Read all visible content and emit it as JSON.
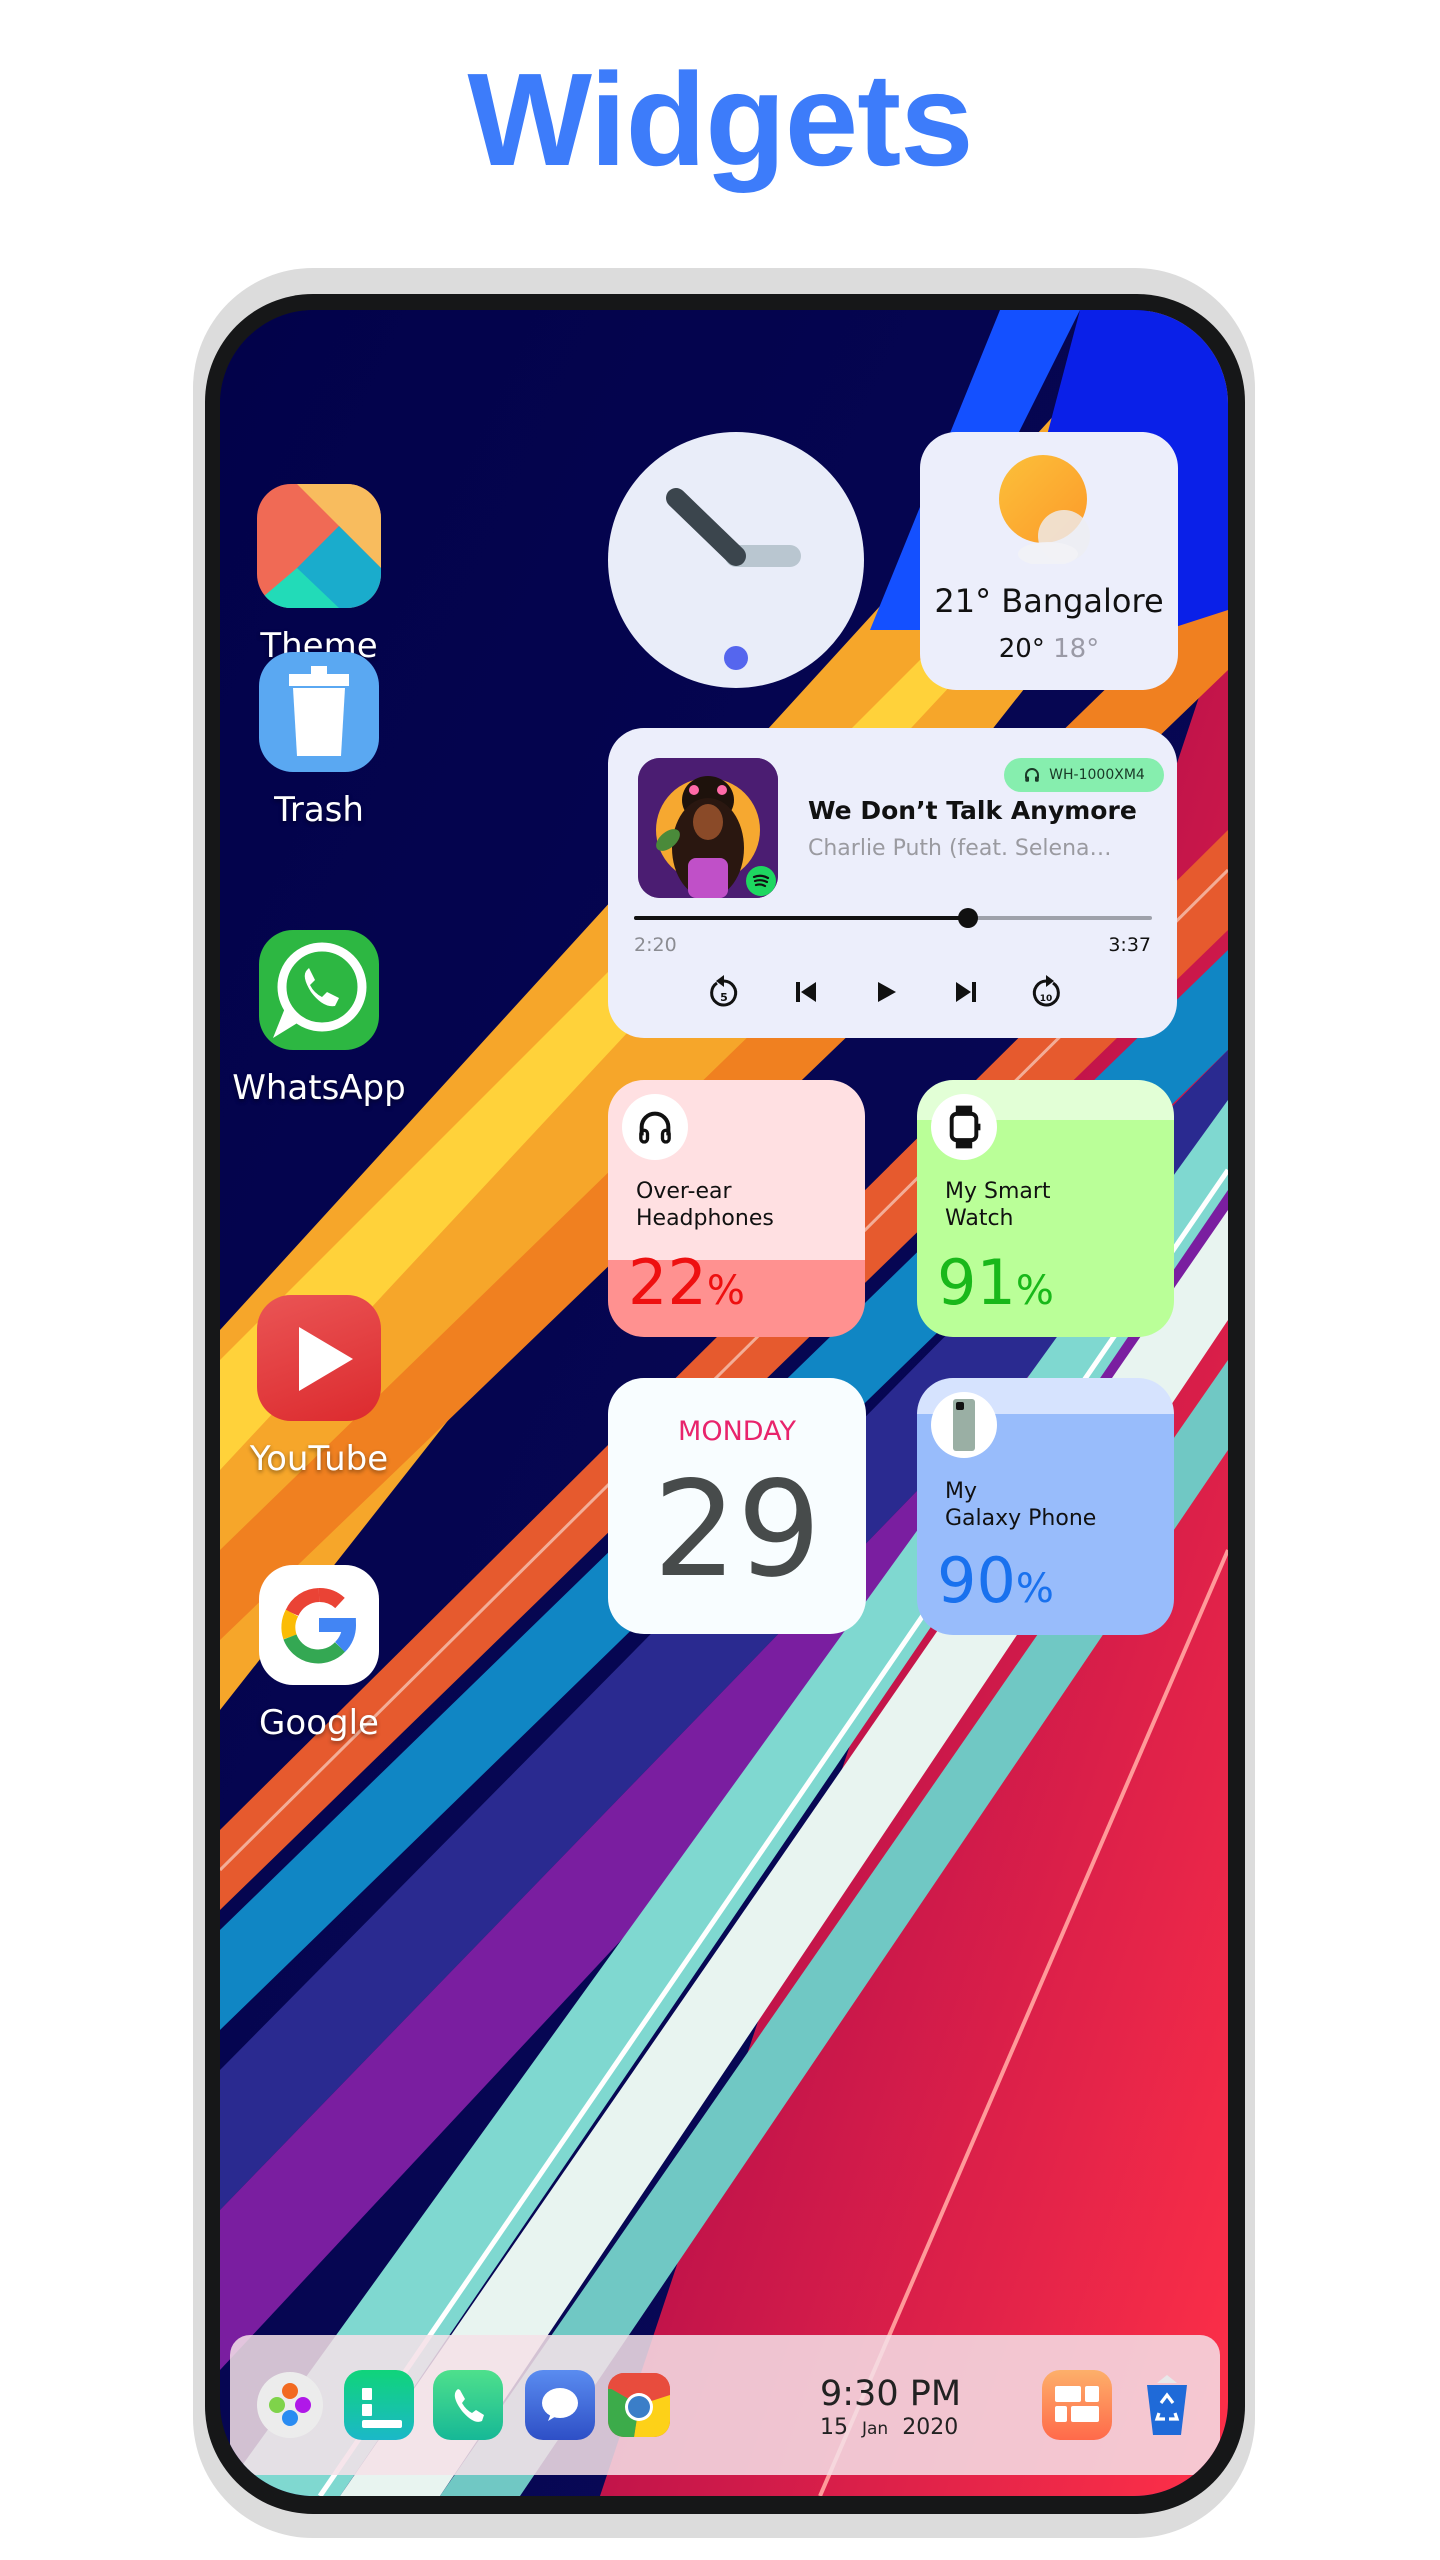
{
  "page": {
    "title": "Widgets",
    "accent_color": "#3d7cfa"
  },
  "home_apps": [
    {
      "label": "Theme",
      "icon": "theme-icon"
    },
    {
      "label": "Trash",
      "icon": "trash-icon"
    },
    {
      "label": "WhatsApp",
      "icon": "whatsapp-icon"
    },
    {
      "label": "YouTube",
      "icon": "youtube-icon"
    },
    {
      "label": "Google",
      "icon": "google-icon"
    }
  ],
  "clock_widget": {
    "icon": "analog-clock-icon"
  },
  "weather_widget": {
    "temperature": "21°",
    "city": "Bangalore",
    "high": "20°",
    "low": "18°",
    "icon": "sun-cloud-icon"
  },
  "music_widget": {
    "device_badge": "WH-1000XM4",
    "song_title": "We Don’t Talk Anymore",
    "artist": "Charlie Puth (feat. Selena…",
    "current_time": "2:20",
    "total_time": "3:37",
    "progress_fraction": 0.645,
    "source_icon": "spotify-icon",
    "controls": [
      {
        "name": "rewind-5-button",
        "icon": "replay-5-icon"
      },
      {
        "name": "previous-button",
        "icon": "skip-previous-icon"
      },
      {
        "name": "play-button",
        "icon": "play-icon"
      },
      {
        "name": "next-button",
        "icon": "skip-next-icon"
      },
      {
        "name": "forward-10-button",
        "icon": "forward-10-icon"
      }
    ]
  },
  "battery_widgets": [
    {
      "name": "Over-ear\nHeadphones",
      "percent": 22,
      "percent_symbol": "%",
      "icon": "headphones-icon",
      "color": "#ee1010"
    },
    {
      "name": "My Smart\nWatch",
      "percent": 91,
      "percent_symbol": "%",
      "icon": "smartwatch-icon",
      "color": "#19b81a"
    },
    {
      "name": "My\nGalaxy Phone",
      "percent": 90,
      "percent_symbol": "%",
      "icon": "phone-icon",
      "color": "#1971ee"
    }
  ],
  "calendar_widget": {
    "weekday": "MONDAY",
    "day": "29"
  },
  "dock": {
    "apps": [
      {
        "name": "launcher",
        "icon": "dots-launcher-icon"
      },
      {
        "name": "widgets-list",
        "icon": "list-icon"
      },
      {
        "name": "phone",
        "icon": "phone-call-icon"
      },
      {
        "name": "messages",
        "icon": "chat-bubble-icon"
      },
      {
        "name": "chrome",
        "icon": "chrome-icon"
      },
      {
        "name": "tiles",
        "icon": "tiles-icon"
      },
      {
        "name": "recycle-bin",
        "icon": "recycle-bin-icon"
      }
    ],
    "time": "9:30 PM",
    "date_day": "15",
    "date_month": "Jan",
    "date_year": "2020"
  }
}
